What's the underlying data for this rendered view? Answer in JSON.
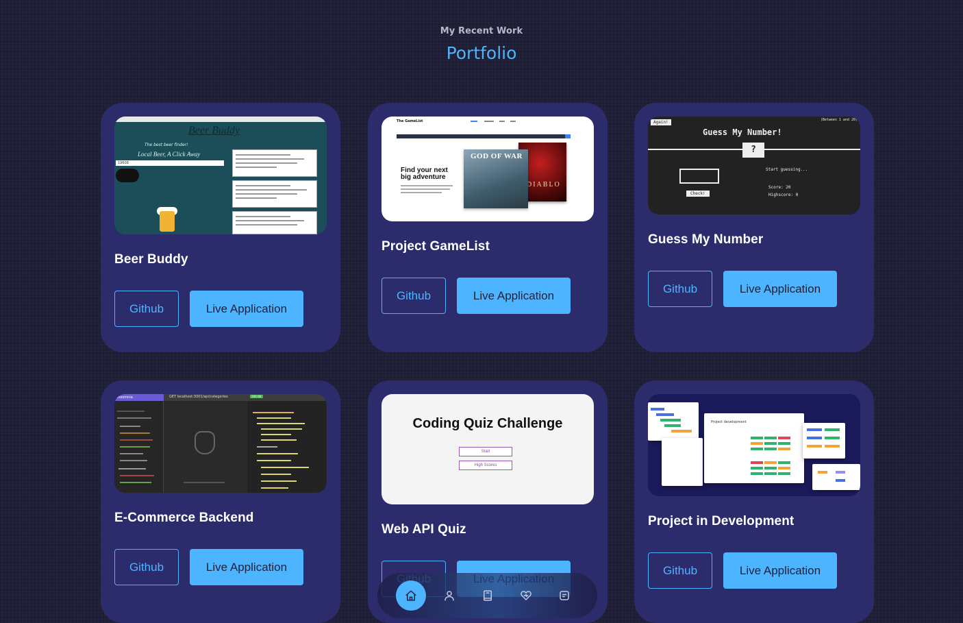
{
  "header": {
    "subtitle": "My Recent Work",
    "title": "Portfolio"
  },
  "projects": [
    {
      "title": "Beer Buddy",
      "github_label": "Github",
      "live_label": "Live Application",
      "thumb": {
        "title": "Beer Buddy",
        "tagline": "The best beer finder!",
        "sub": "Local Beer, A Click Away",
        "search_value": "19608"
      }
    },
    {
      "title": "Project GameList",
      "github_label": "Github",
      "live_label": "Live Application",
      "thumb": {
        "brand": "The GameList",
        "headline_1": "Find your next",
        "headline_2": "big adventure",
        "game_1": "GOD OF WAR",
        "game_2": "DIABLO"
      }
    },
    {
      "title": "Guess My Number",
      "github_label": "Github",
      "live_label": "Live Application",
      "thumb": {
        "again": "Again!",
        "between": "(Between 1 and 20)",
        "heading": "Guess My Number!",
        "mystery": "?",
        "check": "Check!",
        "status": "Start guessing...",
        "score": "Score: 20",
        "highscore": "Highscore: 0"
      }
    },
    {
      "title": "E-Commerce Backend",
      "github_label": "Github",
      "live_label": "Live Application",
      "thumb": {
        "app": "Insomnia",
        "url": "GET  localhost:3001/api/categories",
        "status": "200 OK"
      }
    },
    {
      "title": "Web API Quiz",
      "github_label": "Github",
      "live_label": "Live Application",
      "thumb": {
        "heading": "Coding Quiz Challenge",
        "start": "Start",
        "high_scores": "High Scores"
      }
    },
    {
      "title": "Project in Development",
      "github_label": "Github",
      "live_label": "Live Application",
      "thumb": {
        "panel_title": "Project development"
      }
    }
  ],
  "bottom_nav": {
    "items": [
      "home-icon",
      "user-icon",
      "book-icon",
      "heart-icon",
      "message-icon"
    ],
    "active": "home-icon"
  },
  "colors": {
    "background": "#1f1f38",
    "card": "#2c2c6c",
    "accent": "#4db5ff"
  }
}
